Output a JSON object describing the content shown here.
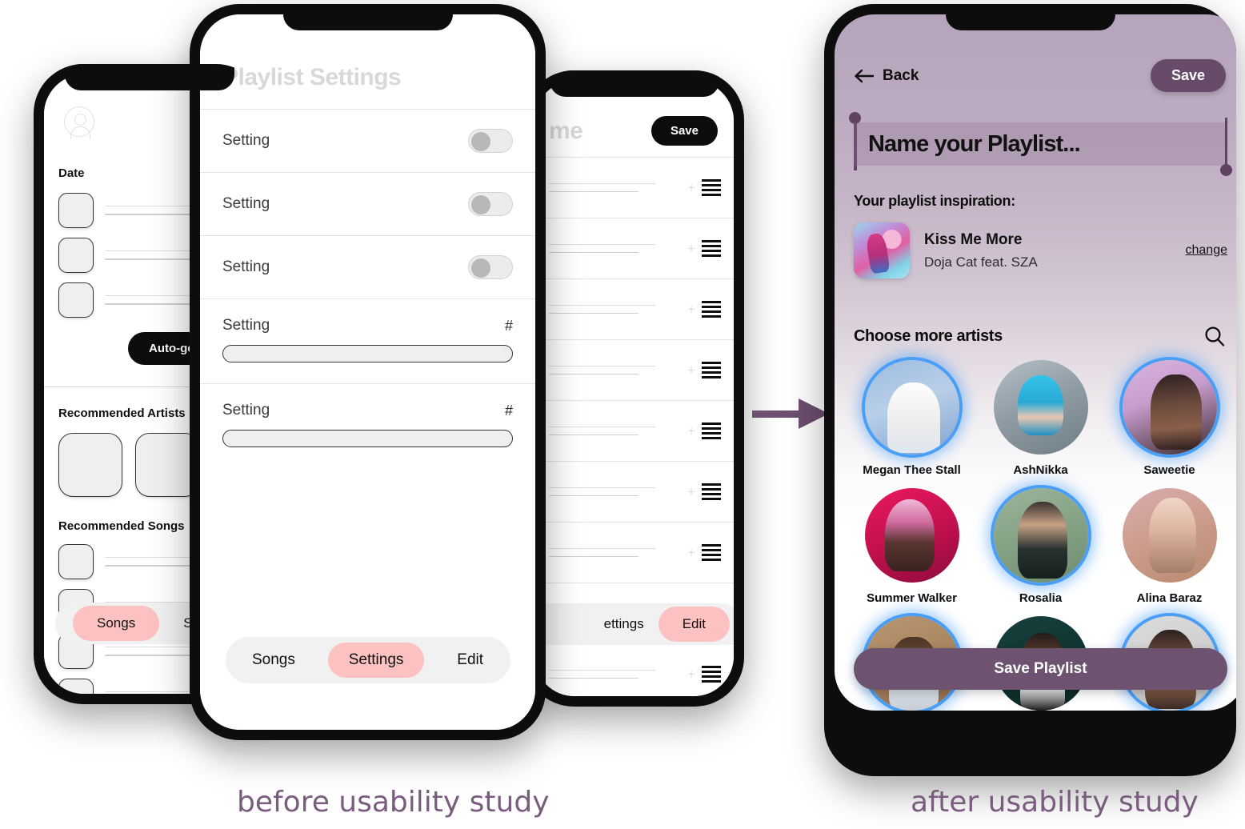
{
  "before": {
    "caption": "before usability study",
    "phone_left": {
      "avatar_icon": "profile-icon",
      "date_label": "Date",
      "date_rows": 3,
      "autogen_button": "Auto-gene",
      "recommended_artists_label": "Recommended Artists",
      "recommended_songs_label": "Recommended Songs",
      "song_rows": 4,
      "tabs": [
        {
          "label": "Songs",
          "active": true
        },
        {
          "label": "Se",
          "active": false
        }
      ]
    },
    "phone_back_right": {
      "title": "me",
      "save_label": "Save",
      "rows": 9,
      "row_handle_icon": "drag-handle-icon",
      "row_plus_icon": "plus-icon",
      "tabs": [
        {
          "label": "ettings",
          "active": false
        },
        {
          "label": "Edit",
          "active": true
        }
      ]
    },
    "phone_mid": {
      "title": "Playlist Settings",
      "toggle_rows": [
        {
          "label": "Setting",
          "on": false
        },
        {
          "label": "Setting",
          "on": false
        },
        {
          "label": "Setting",
          "on": false
        }
      ],
      "slider_rows": [
        {
          "label": "Setting",
          "value_marker": "#"
        },
        {
          "label": "Setting",
          "value_marker": "#"
        }
      ],
      "tabs": [
        {
          "label": "Songs",
          "active": false
        },
        {
          "label": "Settings",
          "active": true
        },
        {
          "label": "Edit",
          "active": false
        }
      ]
    }
  },
  "arrow": {
    "name": "transition-arrow",
    "color": "#6d4f6f"
  },
  "after": {
    "caption": "after usability study",
    "phone": {
      "back_label": "Back",
      "back_icon": "arrow-left-icon",
      "save_label": "Save",
      "playlist_name_placeholder": "Name your Playlist...",
      "inspiration_label": "Your playlist inspiration:",
      "inspiration": {
        "song": "Kiss Me More",
        "artist": "Doja Cat feat. SZA",
        "change_label": "change",
        "artwork_icon": "album-artwork"
      },
      "choose_artists_label": "Choose more artists",
      "search_icon": "search-icon",
      "artists": [
        {
          "name": "Megan Thee Stall",
          "selected": true,
          "photo": "ph1"
        },
        {
          "name": "AshNikka",
          "selected": false,
          "photo": "ph2"
        },
        {
          "name": "Saweetie",
          "selected": true,
          "photo": "ph3"
        },
        {
          "name": "Summer Walker",
          "selected": false,
          "photo": "ph4"
        },
        {
          "name": "Rosalia",
          "selected": true,
          "photo": "ph5"
        },
        {
          "name": "Alina Baraz",
          "selected": false,
          "photo": "ph6"
        },
        {
          "name": "",
          "selected": true,
          "photo": "ph7"
        },
        {
          "name": "",
          "selected": false,
          "photo": "ph8"
        },
        {
          "name": "",
          "selected": true,
          "photo": "ph9"
        }
      ],
      "save_playlist_label": "Save Playlist"
    }
  },
  "colors": {
    "accent_pink": "#fcc2c2",
    "purple": "#674b68",
    "purple_bar": "#6d5370",
    "caption_purple": "#7a5d7e",
    "selection_glow": "#4a9ef5",
    "frame_black": "#0d0d0d"
  }
}
